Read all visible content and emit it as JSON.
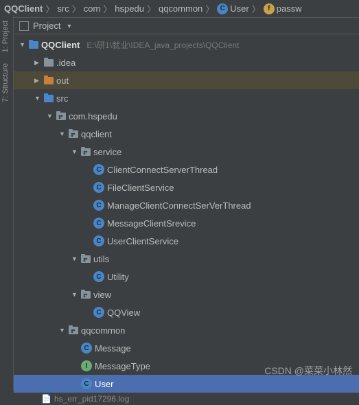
{
  "breadcrumb": {
    "items": [
      {
        "label": "QQClient",
        "bold": true,
        "icon": null
      },
      {
        "label": "src",
        "bold": false,
        "icon": null
      },
      {
        "label": "com",
        "bold": false,
        "icon": null
      },
      {
        "label": "hspedu",
        "bold": false,
        "icon": null
      },
      {
        "label": "qqcommon",
        "bold": false,
        "icon": null
      },
      {
        "label": "User",
        "bold": false,
        "icon": "c"
      },
      {
        "label": "passw",
        "bold": false,
        "icon": "f"
      }
    ]
  },
  "header": {
    "title": "Project"
  },
  "sidebar": {
    "tabs": [
      {
        "label": "1: Project"
      },
      {
        "label": "7: Structure"
      }
    ]
  },
  "tree": {
    "root": {
      "name": "QQClient",
      "path": "E:\\研1\\就业\\IDEA_java_projects\\QQClient"
    },
    "idea": ".idea",
    "out": "out",
    "src": "src",
    "pkg_com": "com.hspedu",
    "pkg_qqclient": "qqclient",
    "pkg_service": "service",
    "service_items": [
      "ClientConnectServerThread",
      "FileClientService",
      "ManageClientConnectSerVerThread",
      "MessageClientSrevice",
      "UserClientService"
    ],
    "pkg_utils": "utils",
    "utils_items": [
      "Utility"
    ],
    "pkg_view": "view",
    "view_items": [
      "QQView"
    ],
    "pkg_qqcommon": "qqcommon",
    "qqcommon_items": [
      {
        "n": "Message",
        "k": "c"
      },
      {
        "n": "MessageType",
        "k": "i"
      },
      {
        "n": "User",
        "k": "c"
      }
    ],
    "bottom_cut": "hs_err_pid17296.log"
  },
  "watermark": "CSDN @菜菜小林然"
}
